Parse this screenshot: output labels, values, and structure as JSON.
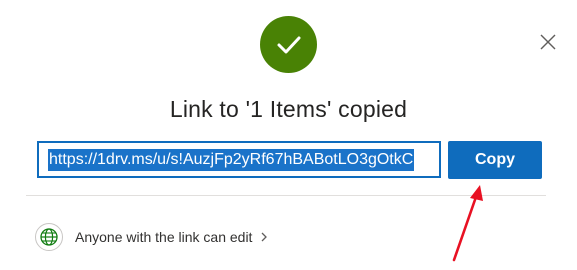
{
  "dialog": {
    "title": "Link to '1 Items' copied",
    "link_value": "https://1drv.ms/u/s!AuzjFp2yRf67hBABotLO3gOtkC",
    "copy_label": "Copy",
    "permission_label": "Anyone with the link can edit"
  },
  "icons": {
    "success": "checkmark-icon",
    "close": "close-icon",
    "globe": "globe-icon",
    "chevron": "chevron-right-icon",
    "annotation": "red-arrow-icon"
  },
  "colors": {
    "success_green": "#498205",
    "primary_blue": "#0f6cbd",
    "selection_blue": "#1a73c9",
    "globe_green": "#107c10",
    "annotation_red": "#e81123"
  }
}
